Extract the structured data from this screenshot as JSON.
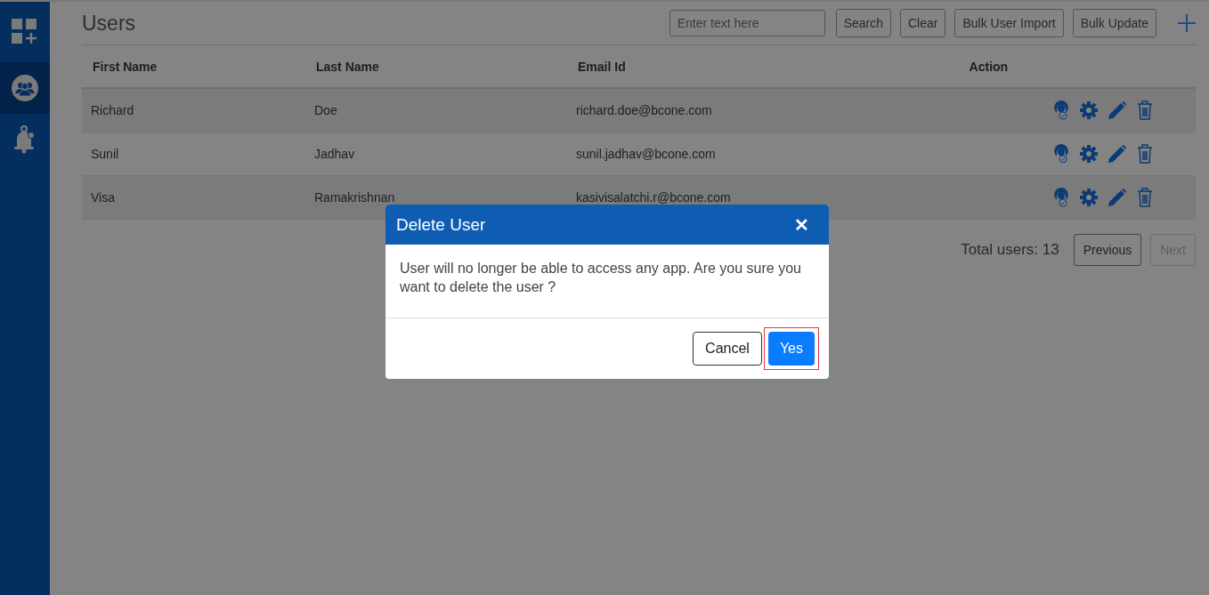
{
  "sidebar": {
    "items": [
      {
        "kind": "apps",
        "selected": false
      },
      {
        "kind": "users",
        "selected": true
      },
      {
        "kind": "notifications",
        "selected": false
      }
    ]
  },
  "page": {
    "title": "Users",
    "search": {
      "placeholder": "Enter text here"
    },
    "buttons": [
      "Search",
      "Clear",
      "Bulk User Import",
      "Bulk Update"
    ]
  },
  "table": {
    "columns": [
      "First Name",
      "Last Name",
      "Email Id",
      "Action"
    ],
    "rows": [
      {
        "cells": [
          "Richard",
          "Doe",
          "richard.doe@bcone.com"
        ]
      },
      {
        "cells": [
          "Sunil",
          "Jadhav",
          "sunil.jadhav@bcone.com"
        ]
      },
      {
        "cells": [
          "Visa",
          "Ramakrishnan",
          "kasivisalatchi.r@bcone.com"
        ]
      }
    ]
  },
  "pagination": {
    "total": "Total users: 13",
    "buttons": [
      {
        "label": "Previous",
        "disabled": false
      },
      {
        "label": "Next",
        "disabled": true
      }
    ]
  },
  "dialog": {
    "title": "Delete User",
    "close": "✕",
    "message": "User will no longer be able to access any app. Are you sure you want to delete the user ?",
    "buttons": [
      {
        "label": "Cancel",
        "kind": "secondary",
        "highlighted": false
      },
      {
        "label": "Yes",
        "kind": "primary",
        "highlighted": true
      }
    ]
  }
}
